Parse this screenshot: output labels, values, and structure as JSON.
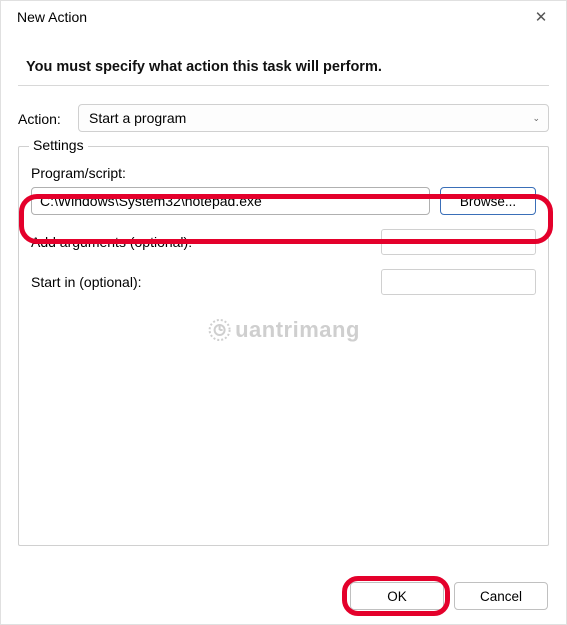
{
  "title": "New Action",
  "instruction": "You must specify what action this task will perform.",
  "action": {
    "label": "Action:",
    "selected": "Start a program"
  },
  "settings": {
    "legend": "Settings",
    "program_label": "Program/script:",
    "program_value": "C:\\Windows\\System32\\notepad.exe",
    "browse_label": "Browse...",
    "args_label": "Add arguments (optional):",
    "args_value": "",
    "startin_label": "Start in (optional):",
    "startin_value": ""
  },
  "buttons": {
    "ok": "OK",
    "cancel": "Cancel"
  },
  "watermark": "uantrimang",
  "colors": {
    "highlight": "#e4002b",
    "browse_border": "#3a6fb8"
  }
}
